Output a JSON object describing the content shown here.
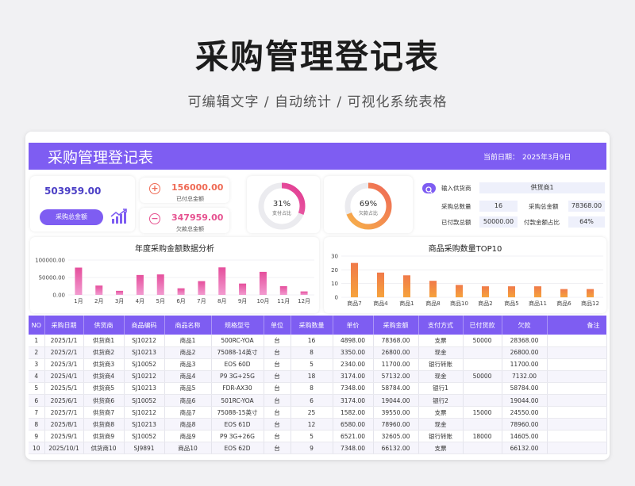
{
  "hero": {
    "title": "采购管理登记表",
    "subtitle": "可编辑文字 / 自动统计 / 可视化系统表格"
  },
  "banner": {
    "title": "采购管理登记表",
    "date_label": "当前日期：",
    "date_value": "2025年3月9日"
  },
  "summary": {
    "total_value": "503959.00",
    "total_button": "采购总金额",
    "paid_value": "156000.00",
    "paid_caption": "已付总金额",
    "owed_value": "347959.00",
    "owed_caption": "欠款总金额"
  },
  "donuts": {
    "paid": {
      "percent_label": "31%",
      "caption": "支付占比",
      "fraction": 0.31
    },
    "owed": {
      "percent_label": "69%",
      "caption": "欠款占比",
      "fraction": 0.69
    }
  },
  "info": {
    "supplier_label": "输入供货商",
    "supplier_value": "供货商1",
    "qty_label": "采购总数量",
    "qty_value": "16",
    "amount_label": "采购总金额",
    "amount_value": "78368.00",
    "paid_label": "已付款总额",
    "paid_value": "50000.00",
    "ratio_label": "付款金额占比",
    "ratio_value": "64%"
  },
  "colors": {
    "accent": "#7e5df2",
    "pink": "#e54f9c",
    "orange": "#f07a4a",
    "amber": "#f6a33c",
    "donut_track": "#ebebef"
  },
  "chart_data": [
    {
      "type": "bar",
      "title": "年度采购金额数据分析",
      "categories": [
        "1月",
        "2月",
        "3月",
        "4月",
        "5月",
        "6月",
        "7月",
        "8月",
        "9月",
        "10月",
        "11月",
        "12月"
      ],
      "values": [
        78368,
        26800,
        11700,
        57132,
        58784,
        19044,
        39550,
        78960,
        32605,
        66132,
        25000,
        10000
      ],
      "yticks": [
        "100000.00",
        "50000.00",
        "0.00"
      ],
      "ylim": [
        0,
        100000
      ],
      "grid": true
    },
    {
      "type": "bar",
      "title": "商品采购数量TOP10",
      "categories": [
        "商品7",
        "商品4",
        "商品1",
        "商品8",
        "商品10",
        "商品2",
        "商品5",
        "商品11",
        "商品6",
        "商品12"
      ],
      "values": [
        25,
        18,
        16,
        12,
        9,
        8,
        8,
        8,
        6,
        6
      ],
      "yticks": [
        "30",
        "20",
        "10",
        "0"
      ],
      "ylim": [
        0,
        30
      ],
      "grid": true
    }
  ],
  "table": {
    "headers": [
      "NO",
      "采购日期",
      "供货商",
      "商品编码",
      "商品名称",
      "规格型号",
      "单位",
      "采购数量",
      "单价",
      "采购金额",
      "支付方式",
      "已付货款",
      "欠款",
      "备注"
    ],
    "rows": [
      [
        "1",
        "2025/1/1",
        "供货商1",
        "SJ10212",
        "商品1",
        "500RC-YOA",
        "台",
        "16",
        "4898.00",
        "78368.00",
        "支票",
        "50000",
        "28368.00",
        ""
      ],
      [
        "2",
        "2025/2/1",
        "供货商2",
        "SJ10213",
        "商品2",
        "75088-14英寸",
        "台",
        "8",
        "3350.00",
        "26800.00",
        "现金",
        "",
        "26800.00",
        ""
      ],
      [
        "3",
        "2025/3/1",
        "供货商3",
        "SJ10052",
        "商品3",
        "EOS 60D",
        "台",
        "5",
        "2340.00",
        "11700.00",
        "银行转账",
        "",
        "11700.00",
        ""
      ],
      [
        "4",
        "2025/4/1",
        "供货商4",
        "SJ10212",
        "商品4",
        "P9 3G+25G",
        "台",
        "18",
        "3174.00",
        "57132.00",
        "现金",
        "50000",
        "7132.00",
        ""
      ],
      [
        "5",
        "2025/5/1",
        "供货商5",
        "SJ10213",
        "商品5",
        "FDR-AX30",
        "台",
        "8",
        "7348.00",
        "58784.00",
        "银行1",
        "",
        "58784.00",
        ""
      ],
      [
        "6",
        "2025/6/1",
        "供货商6",
        "SJ10052",
        "商品6",
        "501RC-YOA",
        "台",
        "6",
        "3174.00",
        "19044.00",
        "银行2",
        "",
        "19044.00",
        ""
      ],
      [
        "7",
        "2025/7/1",
        "供货商7",
        "SJ10212",
        "商品7",
        "75088-15英寸",
        "台",
        "25",
        "1582.00",
        "39550.00",
        "支票",
        "15000",
        "24550.00",
        ""
      ],
      [
        "8",
        "2025/8/1",
        "供货商8",
        "SJ10213",
        "商品8",
        "EOS 61D",
        "台",
        "12",
        "6580.00",
        "78960.00",
        "现金",
        "",
        "78960.00",
        ""
      ],
      [
        "9",
        "2025/9/1",
        "供货商9",
        "SJ10052",
        "商品9",
        "P9 3G+26G",
        "台",
        "5",
        "6521.00",
        "32605.00",
        "银行转账",
        "18000",
        "14605.00",
        ""
      ],
      [
        "10",
        "2025/10/1",
        "供货商10",
        "SJ9891",
        "商品10",
        "EOS 62D",
        "台",
        "9",
        "7348.00",
        "66132.00",
        "支票",
        "",
        "66132.00",
        ""
      ]
    ]
  }
}
